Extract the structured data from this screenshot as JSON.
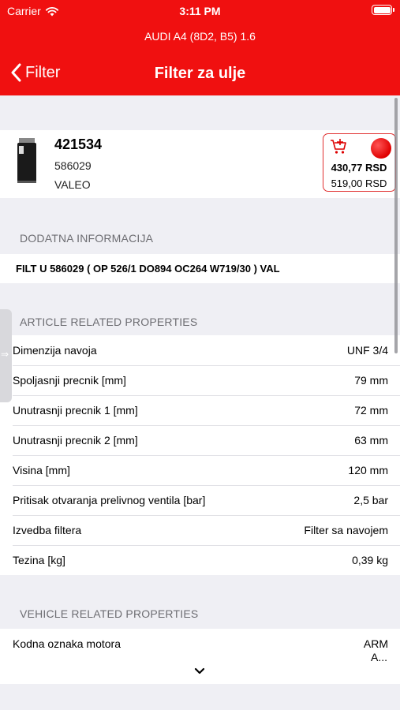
{
  "status_bar": {
    "carrier": "Carrier",
    "time": "3:11 PM"
  },
  "header": {
    "vehicle": "AUDI A4 (8D2, B5) 1.6",
    "back_label": "Filter",
    "title": "Filter za ulje"
  },
  "product": {
    "article_number": "421534",
    "reference": "586029",
    "brand": "VALEO",
    "price_primary": "430,77 RSD",
    "price_secondary": "519,00 RSD",
    "stock_color": "#e00000"
  },
  "sections": {
    "additional_info": "DODATNA INFORMACIJA",
    "article_props": "ARTICLE RELATED PROPERTIES",
    "vehicle_props": "VEHICLE RELATED PROPERTIES"
  },
  "additional_info_text": "FILT U 586029 ( OP 526/1 DO894 OC264 W719/30 ) VAL",
  "article_properties": [
    {
      "label": "Dimenzija navoja",
      "value": "UNF 3/4"
    },
    {
      "label": "Spoljasnji precnik [mm]",
      "value": "79 mm"
    },
    {
      "label": "Unutrasnji precnik 1 [mm]",
      "value": "72 mm"
    },
    {
      "label": "Unutrasnji precnik 2 [mm]",
      "value": "63 mm"
    },
    {
      "label": "Visina [mm]",
      "value": "120 mm"
    },
    {
      "label": "Pritisak otvaranja prelivnog ventila [bar]",
      "value": "2,5 bar"
    },
    {
      "label": "Izvedba filtera",
      "value": "Filter sa navojem"
    },
    {
      "label": "Tezina [kg]",
      "value": "0,39 kg"
    }
  ],
  "vehicle_properties": [
    {
      "label": "Kodna oznaka motora",
      "value_line1": "ARM",
      "value_line2": "A..."
    }
  ],
  "colors": {
    "brand_red": "#f01010",
    "background": "#efeff4"
  }
}
